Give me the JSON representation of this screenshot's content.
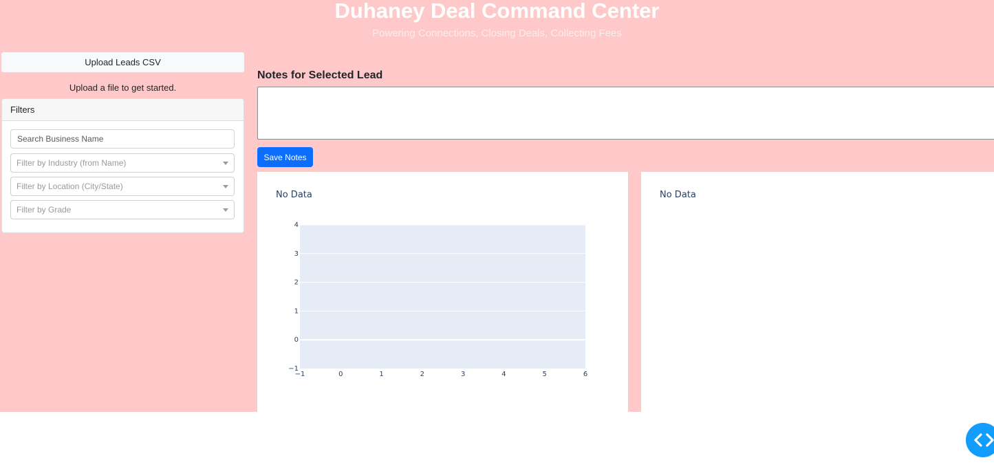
{
  "header": {
    "title": "Duhaney Deal Command Center",
    "subtitle": "Powering Connections, Closing Deals, Collecting Fees"
  },
  "sidebar": {
    "upload_label": "Upload Leads CSV",
    "upload_status": "Upload a file to get started.",
    "filters": {
      "header": "Filters",
      "search_placeholder": "Search Business Name",
      "industry_placeholder": "Filter by Industry (from Name)",
      "location_placeholder": "Filter by Location (City/State)",
      "grade_placeholder": "Filter by Grade"
    }
  },
  "notes": {
    "label": "Notes for Selected Lead",
    "value": "",
    "save_label": "Save Notes"
  },
  "colors": {
    "background": "#ffc9c9",
    "accent": "#0d6efd",
    "plot_bg": "#e5ecf6",
    "toggle": "#119dff"
  },
  "toggle_icon": "code-chevrons-icon",
  "chart_data": [
    {
      "type": "scatter",
      "title": "No Data",
      "series": [],
      "xlim": [
        -1,
        6
      ],
      "ylim": [
        -1,
        4
      ],
      "xticks": [
        "−1",
        "0",
        "1",
        "2",
        "3",
        "4",
        "5",
        "6"
      ],
      "yticks": [
        "−1",
        "0",
        "1",
        "2",
        "3",
        "4"
      ],
      "grid": true
    },
    {
      "type": "scatter",
      "title": "No Data",
      "series": []
    }
  ]
}
